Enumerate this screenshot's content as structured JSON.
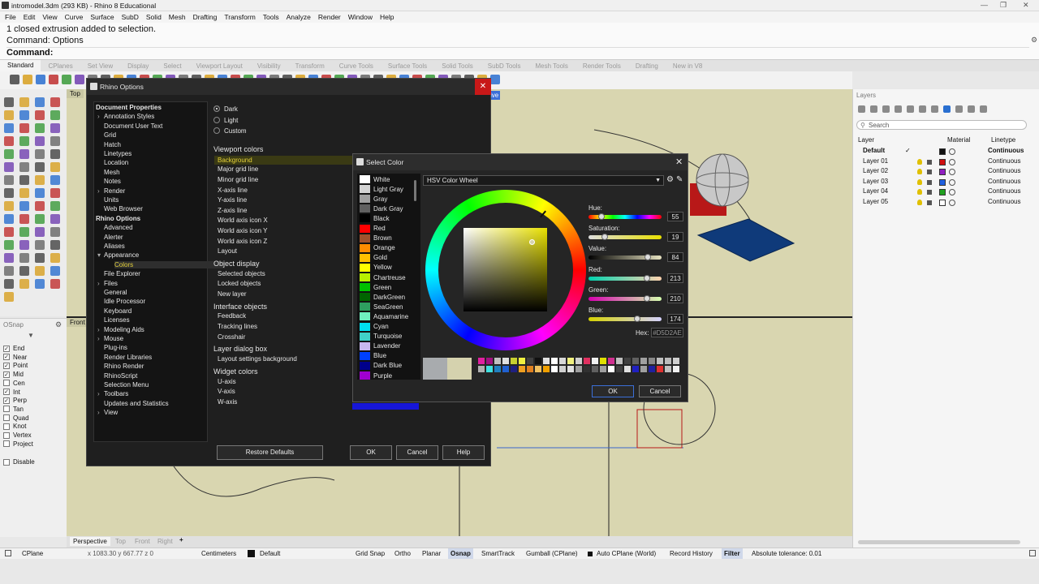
{
  "window": {
    "title": "intromodel.3dm (293 KB) - Rhino 8 Educational"
  },
  "menu": [
    "File",
    "Edit",
    "View",
    "Curve",
    "Surface",
    "SubD",
    "Solid",
    "Mesh",
    "Drafting",
    "Transform",
    "Tools",
    "Analyze",
    "Render",
    "Window",
    "Help"
  ],
  "command": {
    "history": "1 closed extrusion added to selection.",
    "options": "Command:  Options",
    "prompt": "Command:"
  },
  "toolbar_tabs": [
    "Standard",
    "CPlanes",
    "Set View",
    "Display",
    "Select",
    "Viewport Layout",
    "Visibility",
    "Transform",
    "Curve Tools",
    "Surface Tools",
    "Solid Tools",
    "SubD Tools",
    "Mesh Tools",
    "Render Tools",
    "Drafting",
    "New in V8"
  ],
  "viewports": {
    "top": "Top",
    "front": "Front",
    "persp_tab": "Perspective",
    "tabs": [
      "Perspective",
      "Top",
      "Front",
      "Right"
    ],
    "add": "+",
    "cplane_hint": "ive"
  },
  "osnap": {
    "title": "OSnap",
    "items": [
      {
        "label": "End",
        "checked": true
      },
      {
        "label": "Near",
        "checked": true
      },
      {
        "label": "Point",
        "checked": true
      },
      {
        "label": "Mid",
        "checked": true
      },
      {
        "label": "Cen",
        "checked": false
      },
      {
        "label": "Int",
        "checked": true
      },
      {
        "label": "Perp",
        "checked": true
      },
      {
        "label": "Tan",
        "checked": false
      },
      {
        "label": "Quad",
        "checked": false
      },
      {
        "label": "Knot",
        "checked": false
      },
      {
        "label": "Vertex",
        "checked": false
      },
      {
        "label": "Project",
        "checked": false
      }
    ],
    "disable": "Disable"
  },
  "layers": {
    "title": "Layers",
    "search": "Search",
    "col_layer": "Layer",
    "col_material": "Material",
    "col_linetype": "Linetype",
    "rows": [
      {
        "name": "Default",
        "color": "#111111",
        "linetype": "Continuous",
        "bold": true
      },
      {
        "name": "Layer 01",
        "color": "#d01010",
        "linetype": "Continuous",
        "bold": false
      },
      {
        "name": "Layer 02",
        "color": "#9020c0",
        "linetype": "Continuous",
        "bold": false
      },
      {
        "name": "Layer 03",
        "color": "#2060e0",
        "linetype": "Continuous",
        "bold": false
      },
      {
        "name": "Layer 04",
        "color": "#20a020",
        "linetype": "Continuous",
        "bold": false
      },
      {
        "name": "Layer 05",
        "color": "#ffffff",
        "linetype": "Continuous",
        "bold": false
      }
    ]
  },
  "rhino_options": {
    "title": "Rhino Options",
    "tree": [
      {
        "label": "Document Properties",
        "bold": true
      },
      {
        "label": "Annotation Styles",
        "arrow": true
      },
      {
        "label": "Document User Text"
      },
      {
        "label": "Grid"
      },
      {
        "label": "Hatch"
      },
      {
        "label": "Linetypes"
      },
      {
        "label": "Location"
      },
      {
        "label": "Mesh"
      },
      {
        "label": "Notes"
      },
      {
        "label": "Render",
        "arrow": true
      },
      {
        "label": "Units"
      },
      {
        "label": "Web Browser"
      },
      {
        "label": "Rhino Options",
        "bold": true
      },
      {
        "label": "Advanced"
      },
      {
        "label": "Alerter"
      },
      {
        "label": "Aliases"
      },
      {
        "label": "Appearance",
        "arrow": true,
        "open": true
      },
      {
        "label": "Colors",
        "sub": true,
        "selected": true
      },
      {
        "label": "File Explorer"
      },
      {
        "label": "Files",
        "arrow": true
      },
      {
        "label": "General"
      },
      {
        "label": "Idle Processor"
      },
      {
        "label": "Keyboard"
      },
      {
        "label": "Licenses"
      },
      {
        "label": "Modeling Aids",
        "arrow": true
      },
      {
        "label": "Mouse",
        "arrow": true
      },
      {
        "label": "Plug-ins"
      },
      {
        "label": "Render Libraries"
      },
      {
        "label": "Rhino Render"
      },
      {
        "label": "RhinoScript"
      },
      {
        "label": "Selection Menu"
      },
      {
        "label": "Toolbars",
        "arrow": true
      },
      {
        "label": "Updates and Statistics"
      },
      {
        "label": "View",
        "arrow": true
      }
    ],
    "theme": [
      "Dark",
      "Light",
      "Custom"
    ],
    "sections": [
      {
        "title": "Viewport colors",
        "items": [
          "Background",
          "Major grid line",
          "Minor grid line",
          "X-axis line",
          "Y-axis line",
          "Z-axis line",
          "World axis icon X",
          "World axis icon Y",
          "World axis icon Z",
          "Layout"
        ]
      },
      {
        "title": "Object display",
        "items": [
          "Selected objects",
          "Locked objects",
          "New layer"
        ]
      },
      {
        "title": "Interface objects",
        "items": [
          "Feedback",
          "Tracking lines",
          "Crosshair"
        ]
      },
      {
        "title": "Layer dialog box",
        "items": [
          "Layout settings background"
        ]
      },
      {
        "title": "Widget colors",
        "items": [
          "U-axis",
          "V-axis",
          "W-axis"
        ]
      }
    ],
    "buttons": {
      "restore": "Restore Defaults",
      "ok": "OK",
      "cancel": "Cancel",
      "help": "Help"
    }
  },
  "select_color": {
    "title": "Select Color",
    "mode": "HSV Color Wheel",
    "colors": [
      {
        "name": "White",
        "hex": "#ffffff"
      },
      {
        "name": "Light Gray",
        "hex": "#d3d3d3"
      },
      {
        "name": "Gray",
        "hex": "#a0a0a0"
      },
      {
        "name": "Dark Gray",
        "hex": "#606060"
      },
      {
        "name": "Black",
        "hex": "#000000"
      },
      {
        "name": "Red",
        "hex": "#ff0000"
      },
      {
        "name": "Brown",
        "hex": "#a0522d"
      },
      {
        "name": "Orange",
        "hex": "#ff8c00"
      },
      {
        "name": "Gold",
        "hex": "#ffc000"
      },
      {
        "name": "Yellow",
        "hex": "#ffff00"
      },
      {
        "name": "Chartreuse",
        "hex": "#b8f000"
      },
      {
        "name": "Green",
        "hex": "#00c000"
      },
      {
        "name": "DarkGreen",
        "hex": "#006400"
      },
      {
        "name": "SeaGreen",
        "hex": "#2e9f5f"
      },
      {
        "name": "Aquamarine",
        "hex": "#70f0c0"
      },
      {
        "name": "Cyan",
        "hex": "#00e0f0"
      },
      {
        "name": "Turquoise",
        "hex": "#40d0c8"
      },
      {
        "name": "Lavender",
        "hex": "#c8b8f0"
      },
      {
        "name": "Blue",
        "hex": "#0040ff"
      },
      {
        "name": "Dark Blue",
        "hex": "#00008b"
      },
      {
        "name": "Purple",
        "hex": "#a000d0"
      }
    ],
    "hue": {
      "label": "Hue:",
      "value": "55",
      "fraction": 0.15
    },
    "saturation": {
      "label": "Saturation:",
      "value": "19",
      "fraction": 0.19
    },
    "value": {
      "label": "Value:",
      "value": "84",
      "fraction": 0.84
    },
    "red": {
      "label": "Red:",
      "value": "213",
      "fraction": 0.835
    },
    "green": {
      "label": "Green:",
      "value": "210",
      "fraction": 0.824
    },
    "blue": {
      "label": "Blue:",
      "value": "174",
      "fraction": 0.682
    },
    "hex_label": "Hex:",
    "hex": "#D5D2AE",
    "old_color": "#a8abae",
    "new_color": "#d5d2ae",
    "ok": "OK",
    "cancel": "Cancel"
  },
  "status": {
    "cplane": "CPlane",
    "coords": "x 1083.30  y 667.77  z 0",
    "units": "Centimeters",
    "layer": "Default",
    "grid_snap": "Grid Snap",
    "ortho": "Ortho",
    "planar": "Planar",
    "osnap": "Osnap",
    "smarttrack": "SmartTrack",
    "gumball": "Gumball (CPlane)",
    "autocplane": "Auto CPlane (World)",
    "record": "Record History",
    "filter": "Filter",
    "tolerance": "Absolute tolerance: 0.01"
  }
}
